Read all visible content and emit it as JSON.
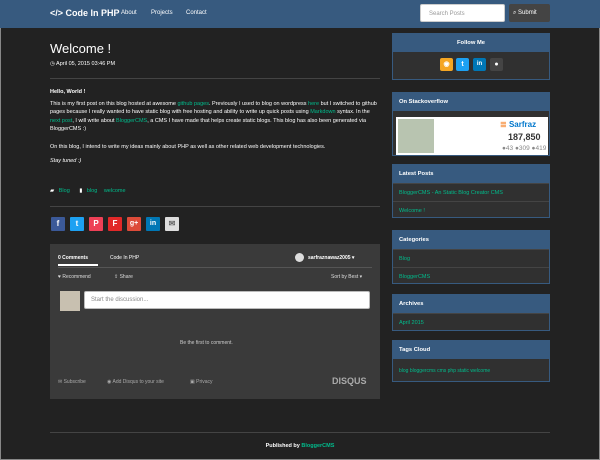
{
  "nav": {
    "brand": "</> Code In PHP",
    "links": [
      "About",
      "Projects",
      "Contact"
    ],
    "search_placeholder": "Search Posts",
    "submit_label": "Submit"
  },
  "post": {
    "title": "Welcome !",
    "date": "April 05, 2015 03:46 PM",
    "hello": "Hello, World !",
    "p1": {
      "t1": "This is my first post on this blog hosted at awesome ",
      "l1": "github pages",
      "t2": ". Previously I used to blog on wordpress ",
      "l2": "here",
      "t3": " but I switched to github pages because I really wanted to have static blog with free hosting and ability to write up quick posts using ",
      "l3": "Markdown",
      "t4": " syntax. In the ",
      "l4": "next post",
      "t5": ", I will write about ",
      "l5": "BloggerCMS",
      "t6": ", a CMS I have made that helps create static blogs. This blog has also been generated via BloggerCMS :)"
    },
    "p2": "On this blog, I intend to write my ideas mainly about PHP as well as other related web development technologies.",
    "p3": "Stay tuned :)",
    "category": "Blog",
    "tags": [
      "blog",
      "welcome"
    ]
  },
  "share_icons": [
    {
      "name": "facebook-icon",
      "glyph": "f",
      "color": "#3b5998"
    },
    {
      "name": "twitter-icon",
      "glyph": "t",
      "color": "#1da1f2"
    },
    {
      "name": "pocket-icon",
      "glyph": "P",
      "color": "#ee4056"
    },
    {
      "name": "flipboard-icon",
      "glyph": "F",
      "color": "#e12828"
    },
    {
      "name": "google-plus-icon",
      "glyph": "g+",
      "color": "#dd4b39"
    },
    {
      "name": "linkedin-icon",
      "glyph": "in",
      "color": "#0077b5"
    },
    {
      "name": "email-icon",
      "glyph": "✉",
      "color": "#dddddd"
    }
  ],
  "disqus": {
    "comments_tab": "0 Comments",
    "site_tab": "Code In PHP",
    "user": "sarfraznawaz2005",
    "recommend": "Recommend",
    "share": "Share",
    "sort": "Sort by Best",
    "placeholder": "Start the discussion...",
    "empty": "Be the first to comment.",
    "subscribe": "Subscribe",
    "add_disqus": "Add Disqus to your site",
    "privacy": "Privacy",
    "logo": "DISQUS"
  },
  "sidebar": {
    "follow_title": "Follow Me",
    "social_icons": [
      {
        "name": "rss-icon",
        "glyph": "◉",
        "color": "#f5a623"
      },
      {
        "name": "twitter-icon",
        "glyph": "t",
        "color": "#1da1f2"
      },
      {
        "name": "linkedin-icon",
        "glyph": "in",
        "color": "#0077b5"
      },
      {
        "name": "github-icon",
        "glyph": "●",
        "color": "#444444"
      }
    ],
    "so_title": "On Stackoverflow",
    "so_name": "Sarfraz",
    "so_rep": "187,850",
    "so_badges": "●43 ●309 ●419",
    "latest_title": "Latest Posts",
    "latest_posts": [
      "BloggerCMS - An Static Blog Creator CMS",
      "Welcome !"
    ],
    "categories_title": "Categories",
    "categories": [
      "Blog",
      "BloggerCMS"
    ],
    "archives_title": "Archives",
    "archives": [
      "April 2015"
    ],
    "tags_title": "Tags Cloud",
    "tags_cloud": "blog bloggercms cms php static welcome"
  },
  "footer": {
    "text": "Published by ",
    "link": "BloggerCMS"
  },
  "colors": {
    "accent": "#00bc8c",
    "navbar": "#375a7f",
    "background": "#222222"
  }
}
